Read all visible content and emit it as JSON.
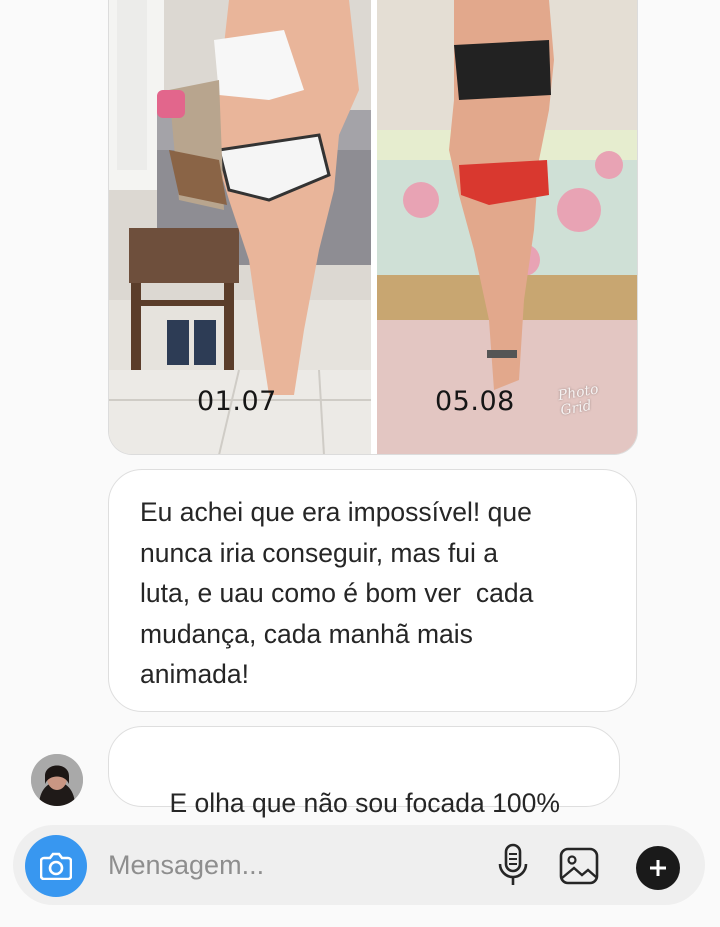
{
  "thread": {
    "photo_message": {
      "left_caption": "01.07",
      "right_caption": "05.08",
      "watermark_line1": "Photo",
      "watermark_line2": "Grid"
    },
    "messages": [
      {
        "lines": [
          "Eu achei que era impossível! que",
          "nunca iria conseguir, mas fui a",
          "luta, e uau como é bom ver  cada",
          "mudança, cada manhã mais",
          "animada!"
        ]
      },
      {
        "text": "E olha que não sou focada 100%"
      }
    ]
  },
  "composer": {
    "placeholder": "Mensagem...",
    "icons": {
      "camera": "camera-icon",
      "mic": "microphone-icon",
      "gallery": "gallery-icon",
      "more": "plus-icon"
    },
    "accent_color": "#3897f0"
  }
}
